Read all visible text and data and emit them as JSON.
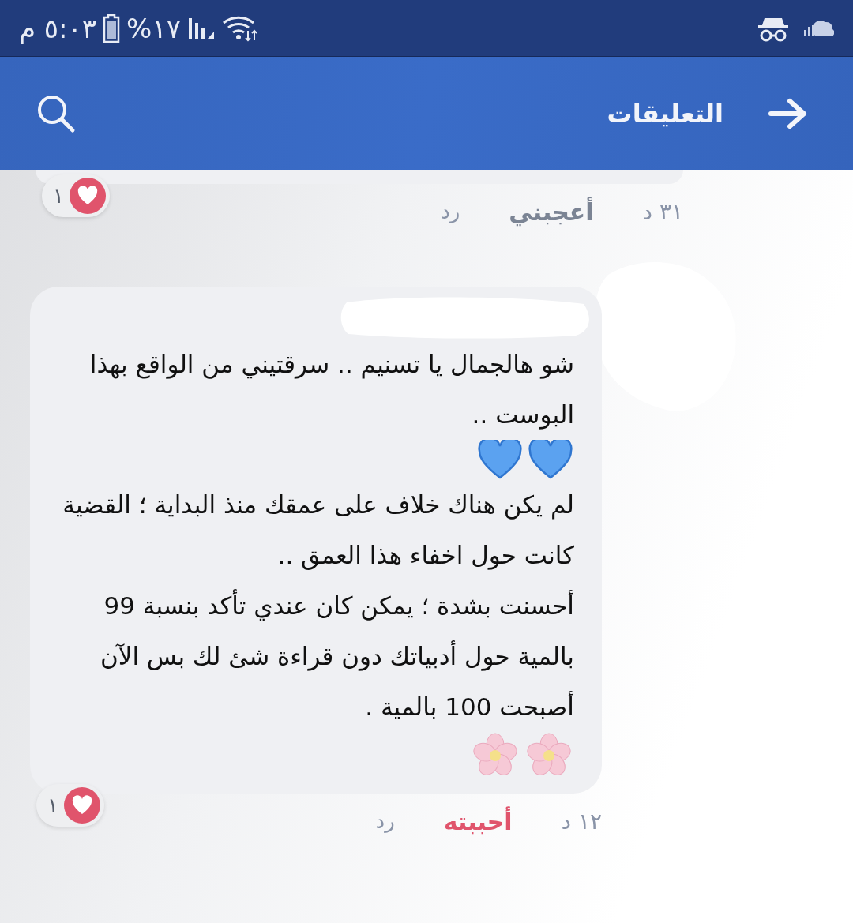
{
  "status_bar": {
    "time": "٥:٠٣ م",
    "battery": "١٧%"
  },
  "header": {
    "title": "التعليقات"
  },
  "comments": [
    {
      "cut_off": true,
      "redacted": false,
      "time": "٣١ د",
      "kind": "like",
      "reaction_label": "أعجبني",
      "reply": "رد",
      "reaction_count": "١"
    },
    {
      "cut_off": false,
      "redacted": true,
      "paragraphs": [
        {
          "text": "شو هالجمال يا تسنيم .. سرقتيني من الواقع بهذا البوست ..",
          "kind": "hearts"
        },
        {
          "text": "لم يكن هناك خلاف  على عمقك منذ البداية ؛ القضية كانت حول اخفاء هذا العمق ..",
          "kind": "plain"
        },
        {
          "text": "أحسنت بشدة ؛ يمكن كان عندي تأكد بنسبة 99 بالمية حول أدبياتك دون قراءة شئ لك بس الآن أصبحت 100 بالمية .",
          "kind": "flowers"
        }
      ],
      "time": "١٢ د",
      "kind": "love",
      "reaction_label": "أحببته",
      "reply": "رد",
      "reaction_count": "١"
    }
  ]
}
